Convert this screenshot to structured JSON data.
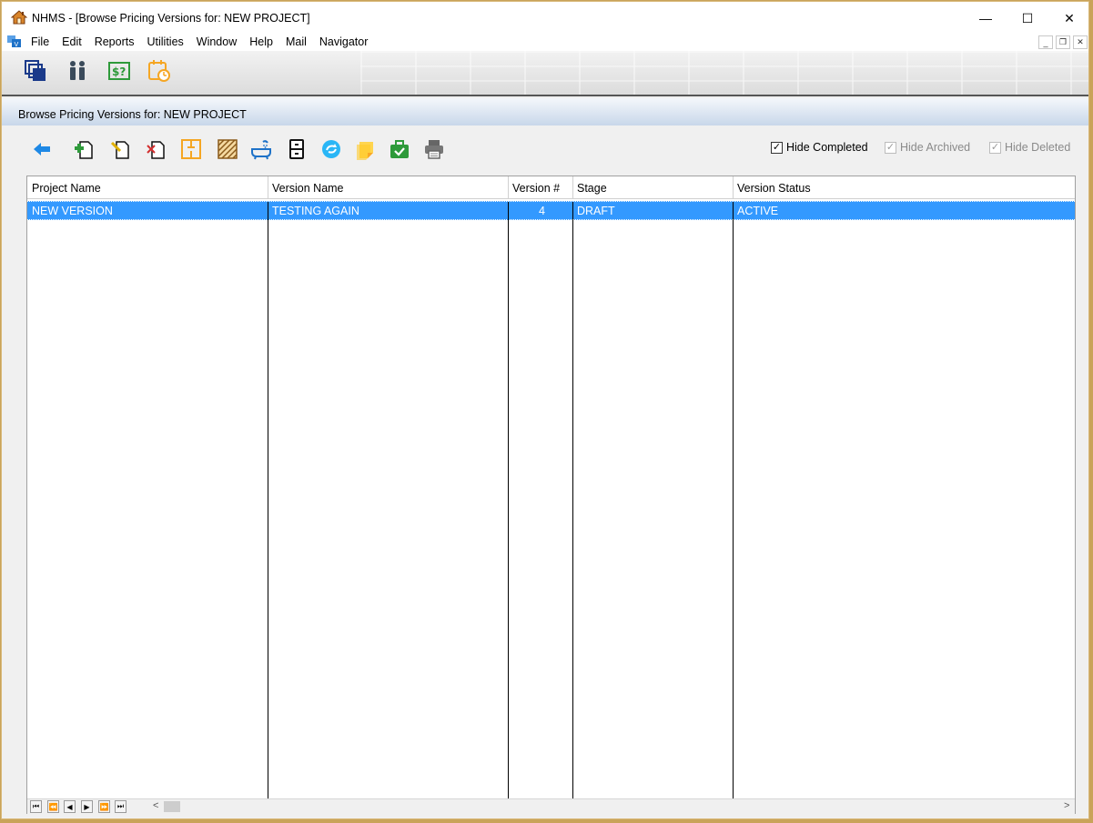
{
  "window": {
    "title": "NHMS - [Browse Pricing Versions for:  NEW PROJECT]",
    "controls": {
      "minimize": "—",
      "maximize": "☐",
      "close": "✕"
    }
  },
  "menu": {
    "items": [
      "File",
      "Edit",
      "Reports",
      "Utilities",
      "Window",
      "Help",
      "Mail",
      "Navigator"
    ],
    "mdi_controls": {
      "minimize": "_",
      "restore": "❐",
      "close": "✕"
    }
  },
  "top_toolbar": {
    "icons": [
      "windows-stack-icon",
      "people-icon",
      "pricing-dollar-icon",
      "calendar-clock-icon"
    ]
  },
  "subheader": {
    "title": "Browse Pricing Versions for:  NEW PROJECT"
  },
  "action_toolbar": {
    "icons": [
      "back-arrow-icon",
      "add-document-icon",
      "edit-document-icon",
      "delete-document-icon",
      "layout-plan-icon",
      "hatched-area-icon",
      "bathtub-icon",
      "cabinet-icon",
      "globe-refresh-icon",
      "sticky-note-icon",
      "briefcase-check-icon",
      "printer-icon"
    ],
    "filters": {
      "hide_completed": {
        "label": "Hide Completed",
        "checked": true,
        "enabled": true
      },
      "hide_archived": {
        "label": "Hide Archived",
        "checked": true,
        "enabled": false
      },
      "hide_deleted": {
        "label": "Hide Deleted",
        "checked": true,
        "enabled": false
      }
    }
  },
  "table": {
    "columns": [
      "Project Name",
      "Version Name",
      "Version #",
      "Stage",
      "Version Status"
    ],
    "rows": [
      {
        "project_name": "NEW VERSION",
        "version_name": "TESTING AGAIN",
        "version_num": "4",
        "stage": "DRAFT",
        "status": "ACTIVE"
      }
    ]
  },
  "navigator": {
    "buttons": [
      "⏮",
      "⏪",
      "◀",
      "▶",
      "⏩",
      "⏭"
    ],
    "scroll_left": "<",
    "scroll_right": ">"
  },
  "colors": {
    "selection": "#3399ff",
    "accent_green": "#2e9a3a",
    "accent_orange": "#f5a623",
    "accent_blue": "#1e72c8"
  }
}
